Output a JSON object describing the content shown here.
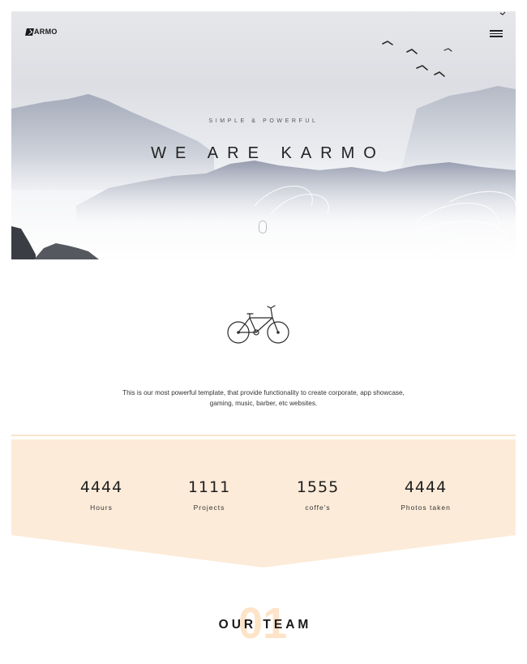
{
  "brand": {
    "logo_text": "ARMO"
  },
  "hero": {
    "tagline": "SIMPLE & POWERFUL",
    "title": "WE ARE KARMO"
  },
  "intro": {
    "text": "This is our most powerful template, that provide functionality to create corporate, app showcase, gaming, music, barber, etc websites."
  },
  "stats": [
    {
      "value": "4444",
      "label": "Hours",
      "ghost": ""
    },
    {
      "value": "1111",
      "label": "Projects",
      "ghost": ""
    },
    {
      "value": "1555",
      "label": "coffe's",
      "ghost": ""
    },
    {
      "value": "4444",
      "label": "Photos taken",
      "ghost": ""
    }
  ],
  "team": {
    "number": "01",
    "title": "OUR TEAM"
  },
  "colors": {
    "accent_band": "#fde9d6",
    "text_dark": "#222222",
    "hero_sky": "#e2e4e8"
  },
  "icons": [
    "logo-mark-icon",
    "hamburger-menu-icon",
    "bicycle-icon",
    "scroll-mouse-icon",
    "bird-icon"
  ]
}
